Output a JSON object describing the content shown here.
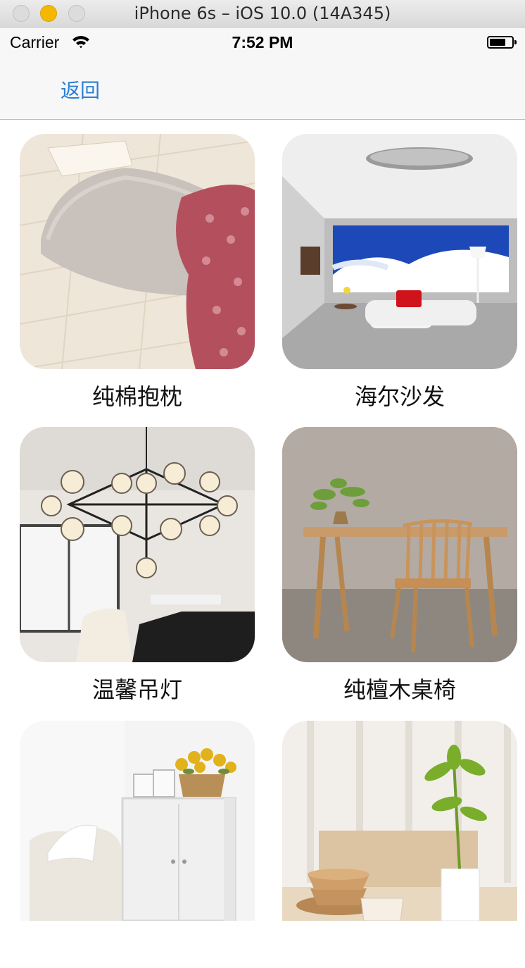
{
  "window": {
    "title": "iPhone 6s – iOS 10.0 (14A345)"
  },
  "status_bar": {
    "carrier": "Carrier",
    "time": "7:52 PM"
  },
  "nav": {
    "back_label": "返回"
  },
  "products": [
    {
      "label": "纯棉抱枕",
      "icon": "pillow-photo"
    },
    {
      "label": "海尔沙发",
      "icon": "sofa-room-photo"
    },
    {
      "label": "温馨吊灯",
      "icon": "chandelier-photo"
    },
    {
      "label": "纯檀木桌椅",
      "icon": "wooden-table-chair-photo"
    },
    {
      "label": "",
      "icon": "cabinet-armchair-photo"
    },
    {
      "label": "",
      "icon": "plant-bowls-photo"
    }
  ],
  "colors": {
    "accent": "#2a7fd4",
    "nav_background": "#f7f7f7",
    "minimize_button": "#f5b800"
  }
}
